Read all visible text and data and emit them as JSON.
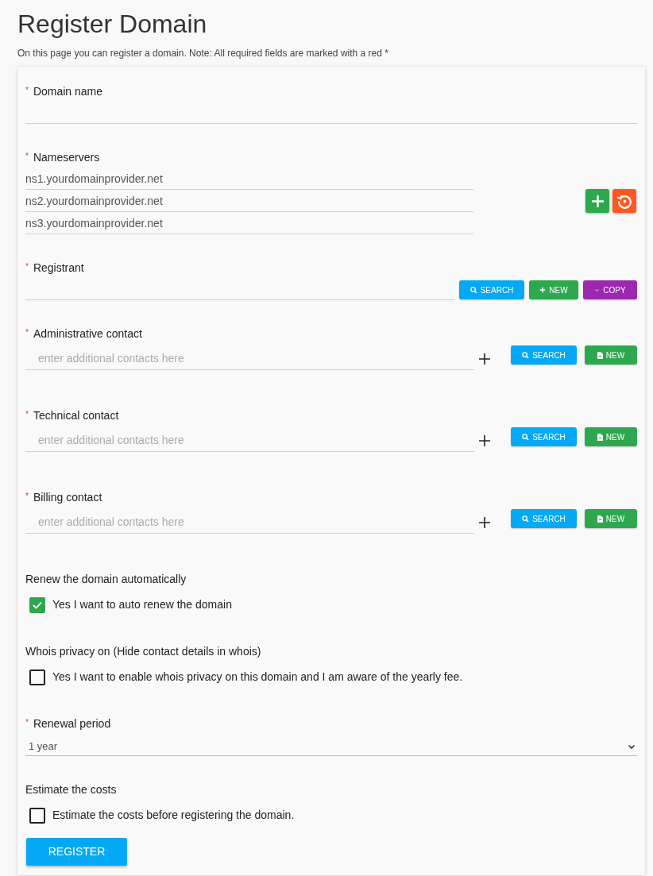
{
  "title": "Register Domain",
  "subtitle": "On this page you can register a domain. Note: All required fields are marked with a red *",
  "sections": [
    {
      "kind": "text",
      "label": "Domain name",
      "marker": "*"
    },
    {
      "kind": "nameservers",
      "label": "Nameservers",
      "marker": "*",
      "values": [
        "ns1.yourdomainprovider.net",
        "ns2.yourdomainprovider.net",
        "ns3.yourdomainprovider.net"
      ]
    },
    {
      "kind": "registrant",
      "label": "Registrant",
      "marker": "*",
      "buttons": [
        {
          "kind": "search",
          "label": "SEARCH"
        },
        {
          "kind": "add",
          "label": "NEW"
        },
        {
          "kind": "copy",
          "label": "COPY"
        }
      ]
    },
    {
      "kind": "contact",
      "label": "Administrative contact",
      "marker": "*",
      "placeholder": "enter additional contacts here",
      "buttons": [
        {
          "kind": "search",
          "label": "SEARCH"
        },
        {
          "kind": "doc",
          "label": "NEW"
        }
      ]
    },
    {
      "kind": "contact",
      "label": "Technical contact",
      "marker": "*",
      "placeholder": "enter additional contacts here",
      "buttons": [
        {
          "kind": "search",
          "label": "SEARCH"
        },
        {
          "kind": "doc",
          "label": "NEW"
        }
      ]
    },
    {
      "kind": "contact",
      "label": "Billing contact",
      "marker": "*",
      "placeholder": "enter additional contacts here",
      "buttons": [
        {
          "kind": "search",
          "label": "SEARCH"
        },
        {
          "kind": "doc",
          "label": "NEW"
        }
      ]
    },
    {
      "kind": "checkbox",
      "label": "Renew the domain automatically",
      "option": "Yes I want to auto renew the domain",
      "checked": true
    },
    {
      "kind": "checkbox",
      "label": "Whois privacy on (Hide contact details in whois)",
      "option": "Yes I want to enable whois privacy on this domain and I am aware of the yearly fee.",
      "checked": false
    },
    {
      "kind": "select",
      "label": "Renewal period",
      "marker": "*",
      "value": "1 year"
    },
    {
      "kind": "checkbox",
      "label": "Estimate the costs",
      "option": "Estimate the costs before registering the domain.",
      "checked": false
    }
  ],
  "submit": "REGISTER"
}
